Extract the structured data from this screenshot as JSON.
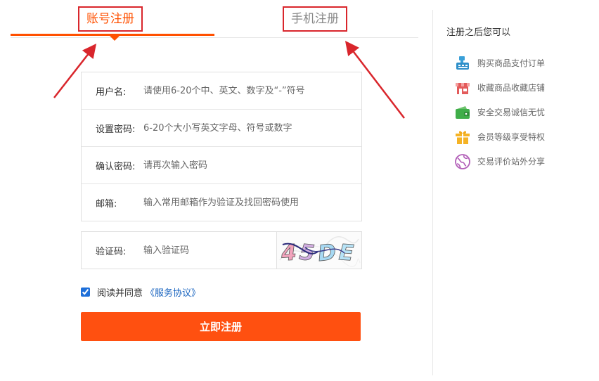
{
  "tabs": {
    "account": "账号注册",
    "phone": "手机注册"
  },
  "form": {
    "username": {
      "label": "用户名:",
      "placeholder": "请使用6-20个中、英文、数字及“-”符号"
    },
    "password": {
      "label": "设置密码:",
      "placeholder": "6-20个大小写英文字母、符号或数字"
    },
    "confirm": {
      "label": "确认密码:",
      "placeholder": "请再次输入密码"
    },
    "email": {
      "label": "邮箱:",
      "placeholder": "输入常用邮箱作为验证及找回密码使用"
    },
    "captcha": {
      "label": "验证码:",
      "placeholder": "输入验证码",
      "image_text": "45DE"
    }
  },
  "agreement": {
    "checked": true,
    "text": "阅读并同意",
    "link": "《服务协议》"
  },
  "submit_label": "立即注册",
  "sidebar": {
    "title": "注册之后您可以",
    "items": [
      {
        "label": "购买商品支付订单",
        "icon": "cash-register-icon"
      },
      {
        "label": "收藏商品收藏店铺",
        "icon": "store-icon"
      },
      {
        "label": "安全交易诚信无忧",
        "icon": "wallet-icon"
      },
      {
        "label": "会员等级享受特权",
        "icon": "gift-icon"
      },
      {
        "label": "交易评价站外分享",
        "icon": "globe-icon"
      }
    ]
  },
  "colors": {
    "accent": "#ff5000",
    "button": "#ff5010",
    "annotation": "#d9262c",
    "link": "#1a65c0"
  }
}
